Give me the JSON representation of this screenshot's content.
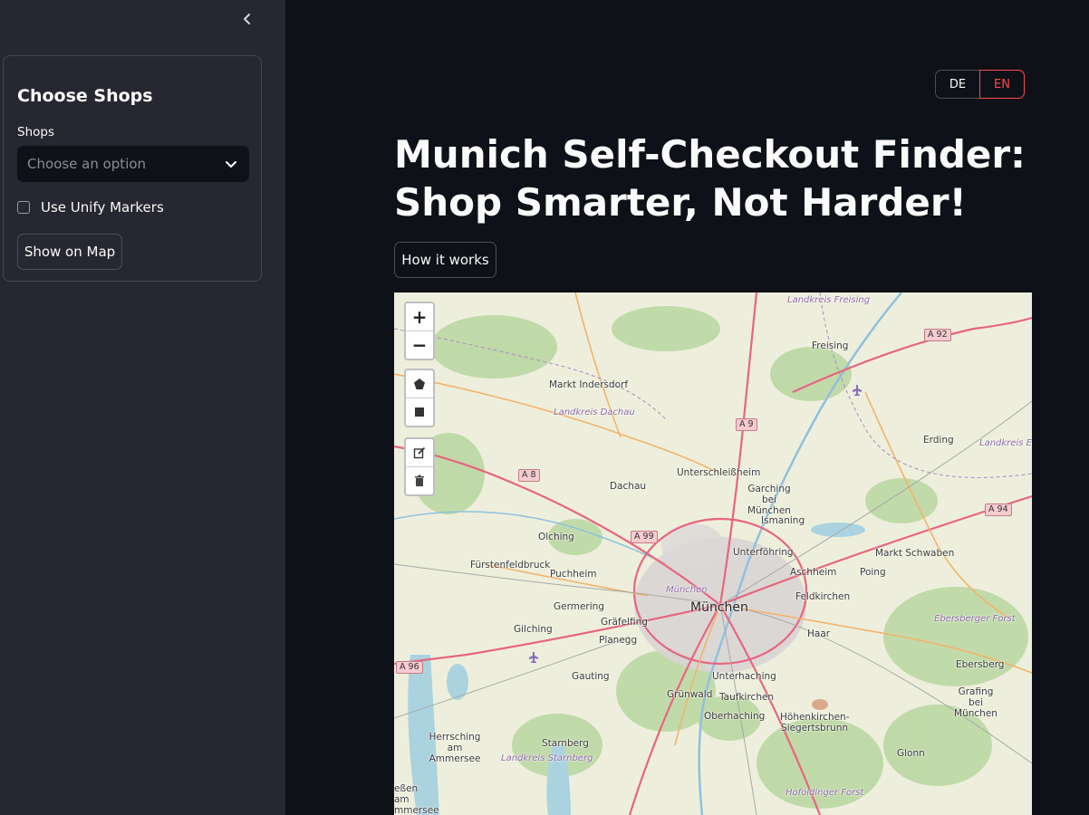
{
  "sidebar": {
    "collapse_icon": "chevron-left-icon",
    "panel_title": "Choose Shops",
    "shops_label": "Shops",
    "shops_placeholder": "Choose an option",
    "unify_markers_label": "Use Unify Markers",
    "unify_markers_checked": false,
    "show_on_map_label": "Show on Map"
  },
  "language": {
    "options": [
      "DE",
      "EN"
    ],
    "selected": "EN"
  },
  "main": {
    "title": "Munich Self-Checkout Finder: Shop Smarter, Not Harder!",
    "how_it_works_label": "How it works"
  },
  "map": {
    "zoom_in": "+",
    "zoom_out": "−",
    "draw_tools": [
      "polygon-icon",
      "rectangle-icon",
      "edit-icon",
      "trash-icon"
    ],
    "places": [
      "Freising",
      "Markt Indersdorf",
      "Erding",
      "Unterschleißheim",
      "Dachau",
      "Garching bei München",
      "Ismaning",
      "Olching",
      "Unterföhring",
      "Fürstenfeldbruck",
      "Puchheim",
      "Aschheim",
      "Markt Schwaben",
      "Poing",
      "München",
      "Feldkirchen",
      "Germering",
      "Gräfelfing",
      "Gilching",
      "Haar",
      "Planegg",
      "Gauting",
      "Unterhaching",
      "Ebersberg",
      "Grünwald",
      "Taufkirchen",
      "Grafing bei München",
      "Oberhaching",
      "Höhenkirchen-Siegertsbrunn",
      "Herrsching am Ammersee",
      "Starnberg",
      "Glonn",
      "eßen am mmersee"
    ],
    "regions": [
      "Landkreis Freising",
      "Landkreis Dachau",
      "Landkreis Erding",
      "München",
      "Ebersberger Forst",
      "Landkreis Starnberg",
      "Hofoldinger Forst"
    ],
    "highways": [
      "A 92",
      "A 9",
      "A 8",
      "A 99",
      "A 94",
      "A 96"
    ]
  }
}
